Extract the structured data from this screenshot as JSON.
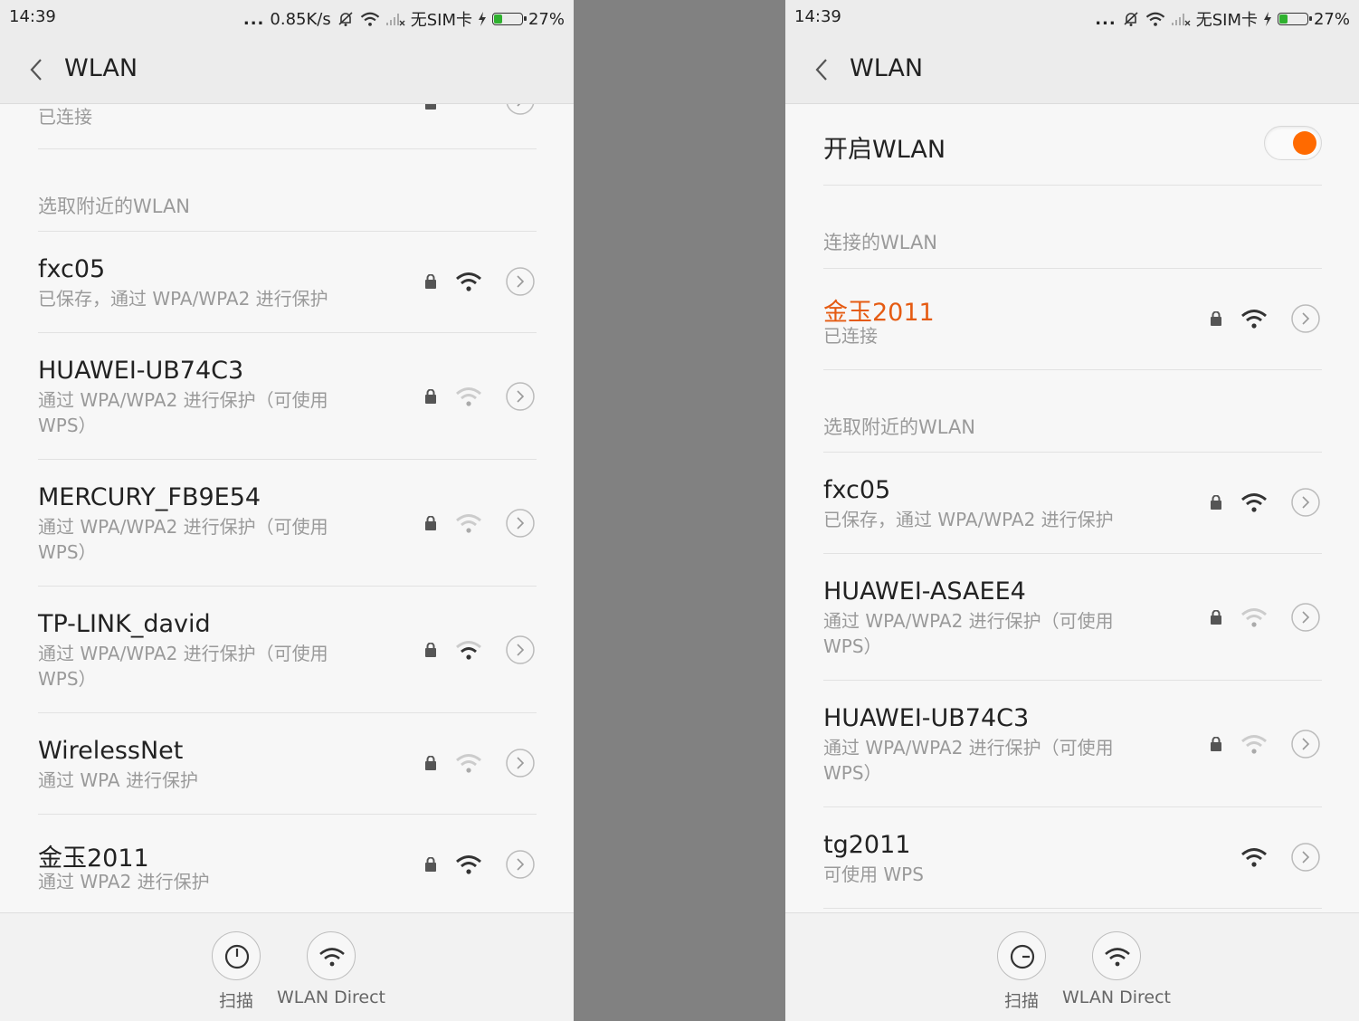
{
  "colors": {
    "accent": "#ff6a00",
    "connected_name": "#e55b12",
    "divider": "#818181"
  },
  "left": {
    "status": {
      "time": "14:39",
      "dots": "...",
      "speed": "0.85K/s",
      "sim": "无SIM卡",
      "battery": "27%",
      "battery_level": 0.27
    },
    "header": {
      "title": "WLAN"
    },
    "partial_status": "已连接",
    "section_label": "选取附近的WLAN",
    "networks": [
      {
        "name": "fxc05",
        "desc": "已保存，通过 WPA/WPA2 进行保护"
      },
      {
        "name": "HUAWEI-UB74C3",
        "desc": "通过 WPA/WPA2 进行保护（可使用 WPS）"
      },
      {
        "name": "MERCURY_FB9E54",
        "desc": "通过 WPA/WPA2 进行保护（可使用 WPS）"
      },
      {
        "name": "TP-LINK_david",
        "desc": "通过 WPA/WPA2 进行保护（可使用 WPS）"
      },
      {
        "name": "WirelessNet",
        "desc": "通过 WPA 进行保护"
      },
      {
        "name": "金玉2011",
        "desc": "通过 WPA2 进行保护"
      }
    ],
    "bottom": {
      "scan": "扫描",
      "direct": "WLAN Direct"
    }
  },
  "right": {
    "status": {
      "time": "14:39",
      "dots": "...",
      "sim": "无SIM卡",
      "battery": "27%",
      "battery_level": 0.27
    },
    "header": {
      "title": "WLAN"
    },
    "toggle_label": "开启WLAN",
    "toggle_on": true,
    "connected_section": "连接的WLAN",
    "connected": {
      "name": "金玉2011",
      "desc": "已连接"
    },
    "section_label": "选取附近的WLAN",
    "networks": [
      {
        "name": "fxc05",
        "desc": "已保存，通过 WPA/WPA2 进行保护"
      },
      {
        "name": "HUAWEI-ASAEE4",
        "desc": "通过 WPA/WPA2 进行保护（可使用 WPS）"
      },
      {
        "name": "HUAWEI-UB74C3",
        "desc": "通过 WPA/WPA2 进行保护（可使用 WPS）"
      },
      {
        "name": "tg2011",
        "desc": "可使用 WPS"
      }
    ],
    "bottom": {
      "scan": "扫描",
      "direct": "WLAN Direct"
    }
  }
}
